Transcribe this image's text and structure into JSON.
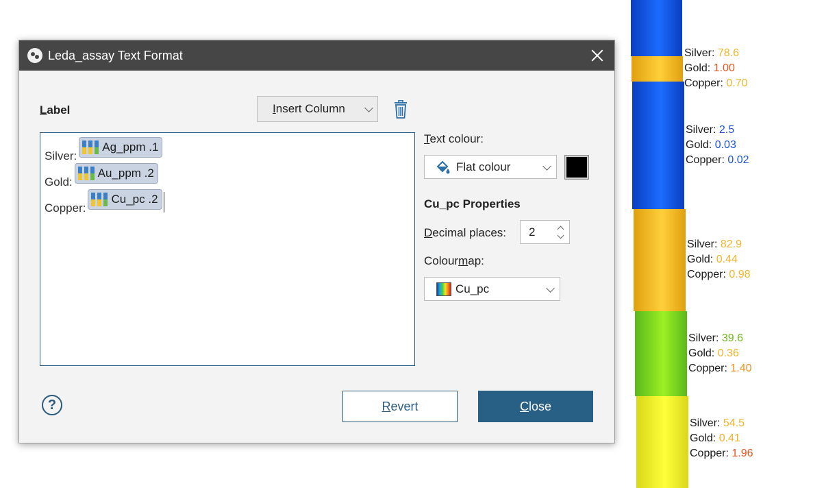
{
  "dialog": {
    "title": "Leda_assay Text Format",
    "label_heading_first": "L",
    "label_heading_rest": "abel",
    "insert_column_first": "I",
    "insert_column_rest": "nsert Column",
    "editor_lines": [
      {
        "prefix": "Silver:",
        "chip": "Ag_ppm .1"
      },
      {
        "prefix": "Gold:",
        "chip": "Au_ppm .2"
      },
      {
        "prefix": "Copper:",
        "chip": "Cu_pc .2"
      }
    ],
    "text_colour_first": "T",
    "text_colour_rest": "ext colour:",
    "text_colour_value": "Flat colour",
    "text_colour_swatch": "#000000",
    "properties_heading": "Cu_pc Properties",
    "decimal_first": "D",
    "decimal_rest": "ecimal places:",
    "decimal_value": "2",
    "colourmap_a": "Colour",
    "colourmap_u": "m",
    "colourmap_b": "ap:",
    "colourmap_value": "Cu_pc",
    "help_glyph": "?",
    "revert_first": "R",
    "revert_rest": "evert",
    "close_first": "C",
    "close_rest": "lose"
  },
  "drillhole": {
    "labels": [
      {
        "silver": "78.6",
        "gold": "1.00",
        "copper": "0.70",
        "silver_color": "#f0b429",
        "gold_color": "#e8541c",
        "copper_color": "#f0b429"
      },
      {
        "silver": "2.5",
        "gold": "0.03",
        "copper": "0.02",
        "silver_color": "#1f55d8",
        "gold_color": "#1f55d8",
        "copper_color": "#1f55d8"
      },
      {
        "silver": "82.9",
        "gold": "0.44",
        "copper": "0.98",
        "silver_color": "#f0b429",
        "gold_color": "#f0b429",
        "copper_color": "#f0b429"
      },
      {
        "silver": "39.6",
        "gold": "0.36",
        "copper": "1.40",
        "silver_color": "#6cb81e",
        "gold_color": "#f0b429",
        "copper_color": "#f09020"
      },
      {
        "silver": "54.5",
        "gold": "0.41",
        "copper": "1.96",
        "silver_color": "#f0b429",
        "gold_color": "#f0b429",
        "copper_color": "#e8541c"
      }
    ],
    "word_silver": "Silver:",
    "word_gold": "Gold:",
    "word_copper": "Copper:"
  }
}
